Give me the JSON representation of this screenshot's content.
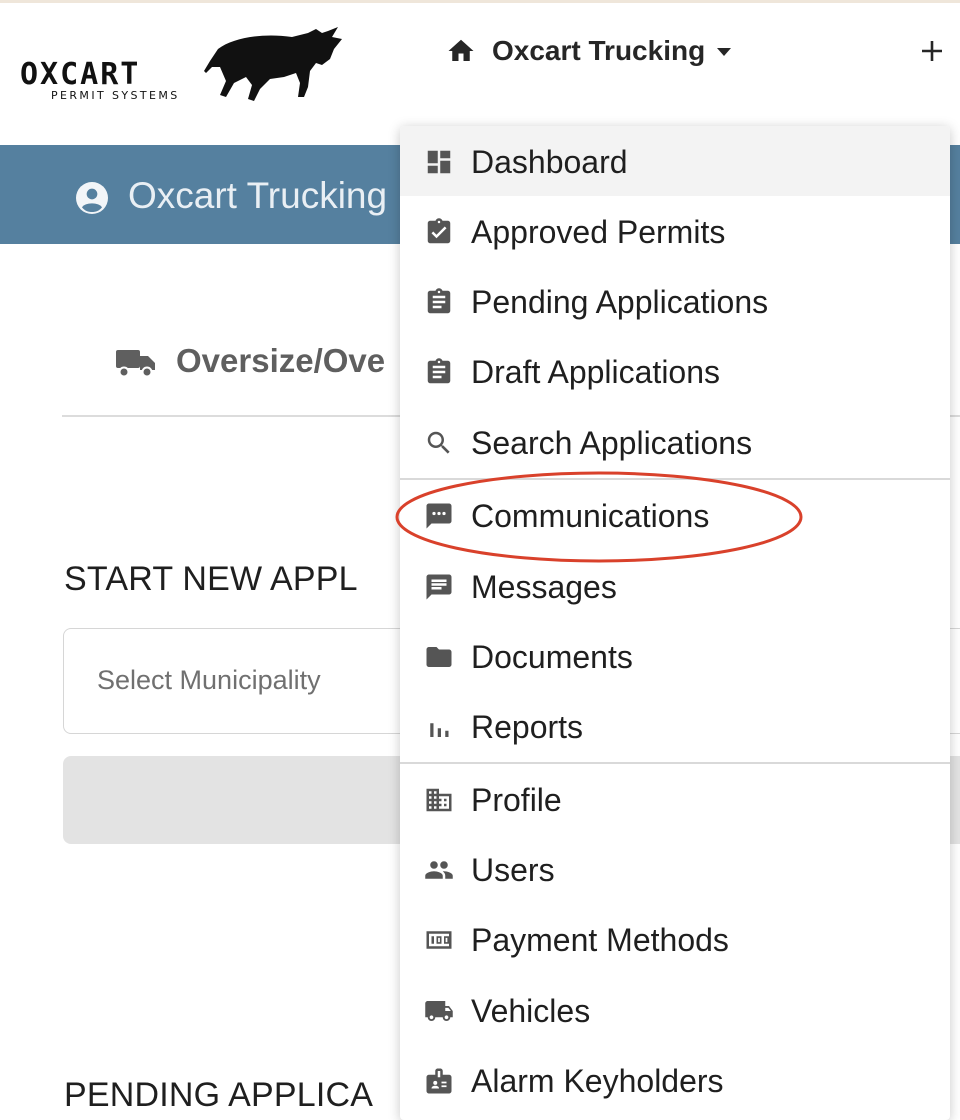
{
  "header": {
    "logo_word": "OXCART",
    "logo_sub": "PERMIT SYSTEMS",
    "account_name": "Oxcart Trucking",
    "icons": {
      "home": "home-icon",
      "caret": "caret-down-icon",
      "plus": "plus-icon"
    }
  },
  "banner": {
    "user_name": "Oxcart Trucking",
    "icon": "account-circle-icon",
    "color": "#55809f"
  },
  "tab": {
    "label": "Oversize/Ove",
    "icon": "truck-icon"
  },
  "start_section": {
    "title": "START NEW APPL",
    "select_placeholder": "Select Municipality"
  },
  "pending_section": {
    "title": "PENDING APPLICA"
  },
  "dropdown": {
    "items": [
      {
        "label": "Dashboard",
        "icon": "dashboard-icon",
        "active": true
      },
      {
        "label": "Approved Permits",
        "icon": "clipboard-check-icon"
      },
      {
        "label": "Pending Applications",
        "icon": "clipboard-icon"
      },
      {
        "label": "Draft Applications",
        "icon": "clipboard-icon"
      },
      {
        "label": "Search Applications",
        "icon": "search-icon"
      },
      {
        "label": "Communications",
        "icon": "chat-dots-icon",
        "highlighted": true
      },
      {
        "label": "Messages",
        "icon": "message-icon"
      },
      {
        "label": "Documents",
        "icon": "folder-icon"
      },
      {
        "label": "Reports",
        "icon": "bar-chart-icon"
      },
      {
        "label": "Profile",
        "icon": "building-icon"
      },
      {
        "label": "Users",
        "icon": "people-icon"
      },
      {
        "label": "Payment Methods",
        "icon": "money-icon"
      },
      {
        "label": "Vehicles",
        "icon": "truck-icon"
      },
      {
        "label": "Alarm Keyholders",
        "icon": "badge-icon"
      }
    ],
    "highlight_color": "#d9412b"
  }
}
